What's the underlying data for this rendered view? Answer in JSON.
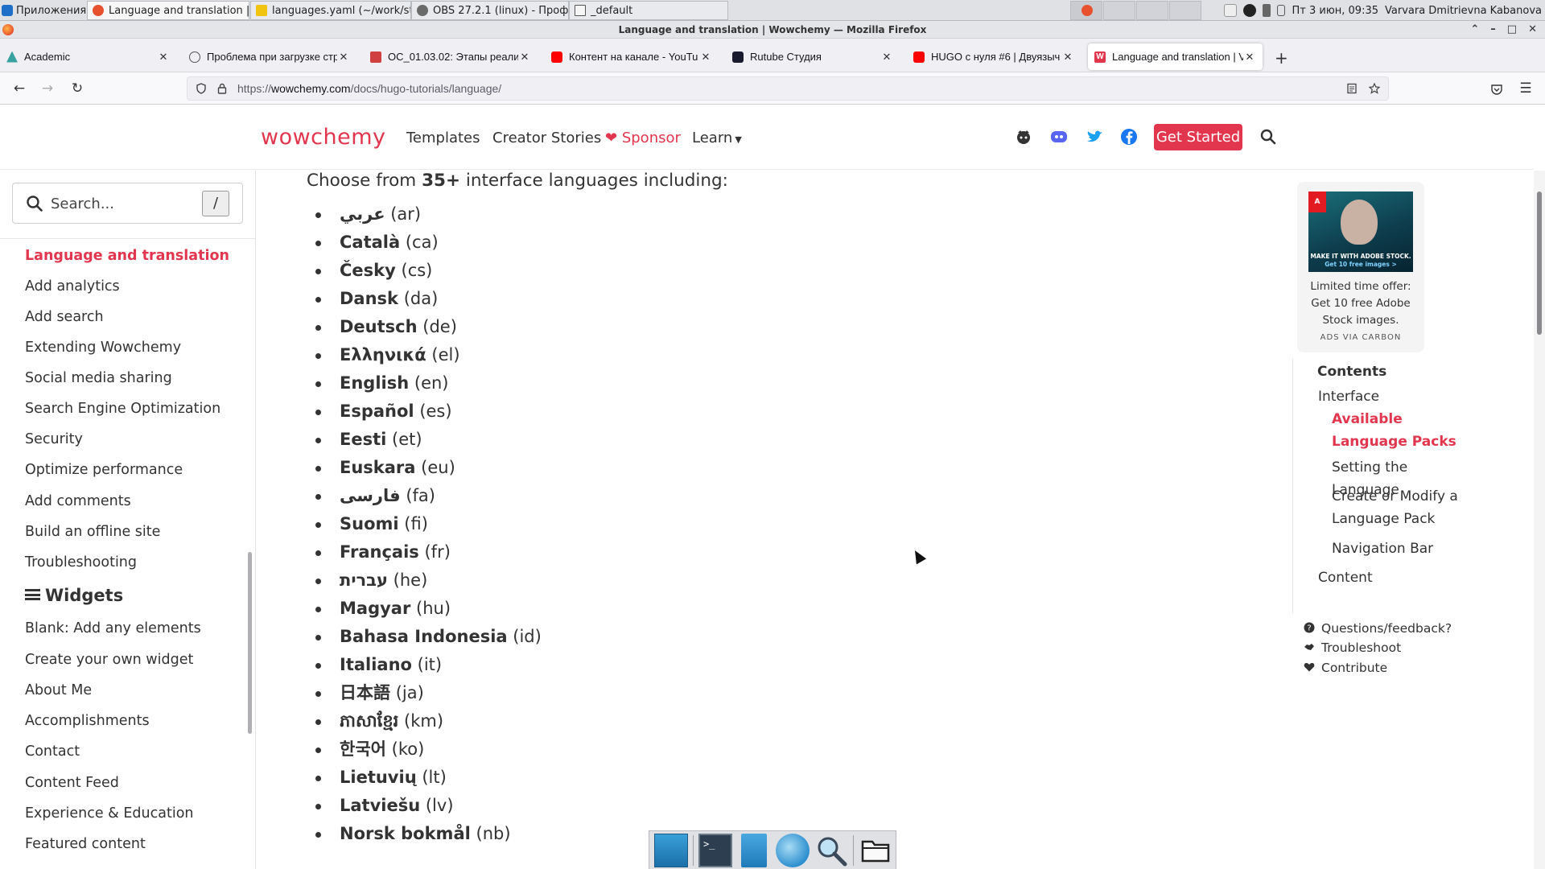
{
  "os_panel": {
    "apps_label": "Приложения",
    "tasks": [
      {
        "label": "Language and translation | ...",
        "icon": "firefox-icon"
      },
      {
        "label": "languages.yaml (~/work/st...",
        "icon": "text-editor-icon"
      },
      {
        "label": "OBS 27.2.1 (linux) - Проф...",
        "icon": "obs-icon"
      },
      {
        "label": "_default",
        "icon": "folder-icon"
      }
    ],
    "clock": "Пт  3 июн, 09:35",
    "user": "Varvara Dmitrievna Kabanova"
  },
  "window": {
    "title": "Language and translation | Wowchemy — Mozilla Firefox"
  },
  "tabs": [
    {
      "label": "Academic",
      "icon": "academic-icon",
      "icon_color": "#3aa1a1"
    },
    {
      "label": "Проблема при загрузке стр",
      "icon": "info-icon",
      "icon_color": "#555555"
    },
    {
      "label": "OC_01.03.02: Этапы реали",
      "icon": "document-icon",
      "icon_color": "#d04040"
    },
    {
      "label": "Контент на канале - YouTu",
      "icon": "youtube-icon",
      "icon_color": "#ff0000"
    },
    {
      "label": "Rutube Студия",
      "icon": "rutube-icon",
      "icon_color": "#1a1a2e"
    },
    {
      "label": "HUGO с нуля #6 | Двуязыч",
      "icon": "youtube-icon",
      "icon_color": "#ff0000"
    },
    {
      "label": "Language and translation | V",
      "icon": "wowchemy-icon",
      "icon_color": "#e2364f"
    }
  ],
  "nav": {
    "url_prefix": "https://",
    "url_domain": "wowchemy.com",
    "url_path": "/docs/hugo-tutorials/language/"
  },
  "site_header": {
    "logo": "wowchemy",
    "menu": [
      "Templates",
      "Creator Stories",
      "Sponsor",
      "Learn"
    ],
    "cta": "Get Started"
  },
  "sidebar": {
    "search_placeholder": "Search...",
    "search_shortcut": "/",
    "items": [
      "Language and translation",
      "Add analytics",
      "Add search",
      "Extending Wowchemy",
      "Social media sharing",
      "Search Engine Optimization",
      "Security",
      "Optimize performance",
      "Add comments",
      "Build an offline site",
      "Troubleshooting"
    ],
    "widgets_heading": "Widgets",
    "widgets": [
      "Blank: Add any elements",
      "Create your own widget",
      "About Me",
      "Accomplishments",
      "Contact",
      "Content Feed",
      "Experience & Education",
      "Featured content"
    ]
  },
  "main": {
    "intro_pre": "Choose from ",
    "intro_bold": "35+",
    "intro_post": " interface languages including:",
    "languages": [
      {
        "name": "عربي",
        "code": "(ar)"
      },
      {
        "name": "Català",
        "code": "(ca)"
      },
      {
        "name": "Česky",
        "code": "(cs)"
      },
      {
        "name": "Dansk",
        "code": "(da)"
      },
      {
        "name": "Deutsch",
        "code": "(de)"
      },
      {
        "name": "Ελληνικά",
        "code": "(el)"
      },
      {
        "name": "English",
        "code": "(en)"
      },
      {
        "name": "Español",
        "code": "(es)"
      },
      {
        "name": "Eesti",
        "code": "(et)"
      },
      {
        "name": "Euskara",
        "code": "(eu)"
      },
      {
        "name": "فارسی",
        "code": "(fa)"
      },
      {
        "name": "Suomi",
        "code": "(fi)"
      },
      {
        "name": "Français",
        "code": "(fr)"
      },
      {
        "name": "עברית",
        "code": "(he)"
      },
      {
        "name": "Magyar",
        "code": "(hu)"
      },
      {
        "name": "Bahasa Indonesia",
        "code": "(id)"
      },
      {
        "name": "Italiano",
        "code": "(it)"
      },
      {
        "name": "日本語",
        "code": "(ja)"
      },
      {
        "name": "ភាសាខ្មែរ",
        "code": "(km)"
      },
      {
        "name": "한국어",
        "code": "(ko)"
      },
      {
        "name": "Lietuvių",
        "code": "(lt)"
      },
      {
        "name": "Latviešu",
        "code": "(lv)"
      },
      {
        "name": "Norsk bokmål",
        "code": "(nb)"
      }
    ]
  },
  "ad": {
    "image_caption": "MAKE IT WITH ADOBE STOCK.",
    "image_sub": "Get 10 free images >",
    "text": "Limited time offer: Get 10 free Adobe Stock images.",
    "via": "ADS VIA CARBON"
  },
  "toc": {
    "heading": "Contents",
    "items": [
      {
        "label": "Interface",
        "level": 1,
        "active": false
      },
      {
        "label": "Available Language Packs",
        "level": 2,
        "active": true
      },
      {
        "label": "Setting the Language",
        "level": 2,
        "active": false
      },
      {
        "label": "Create or Modify a Language Pack",
        "level": 2,
        "active": false
      },
      {
        "label": "Navigation Bar",
        "level": 2,
        "active": false
      },
      {
        "label": "Content",
        "level": 1,
        "active": false
      }
    ]
  },
  "help": {
    "questions": "Questions/feedback?",
    "troubleshoot": "Troubleshoot",
    "contribute": "Contribute"
  },
  "colors": {
    "brand": "#e2364f",
    "text": "#333333"
  }
}
